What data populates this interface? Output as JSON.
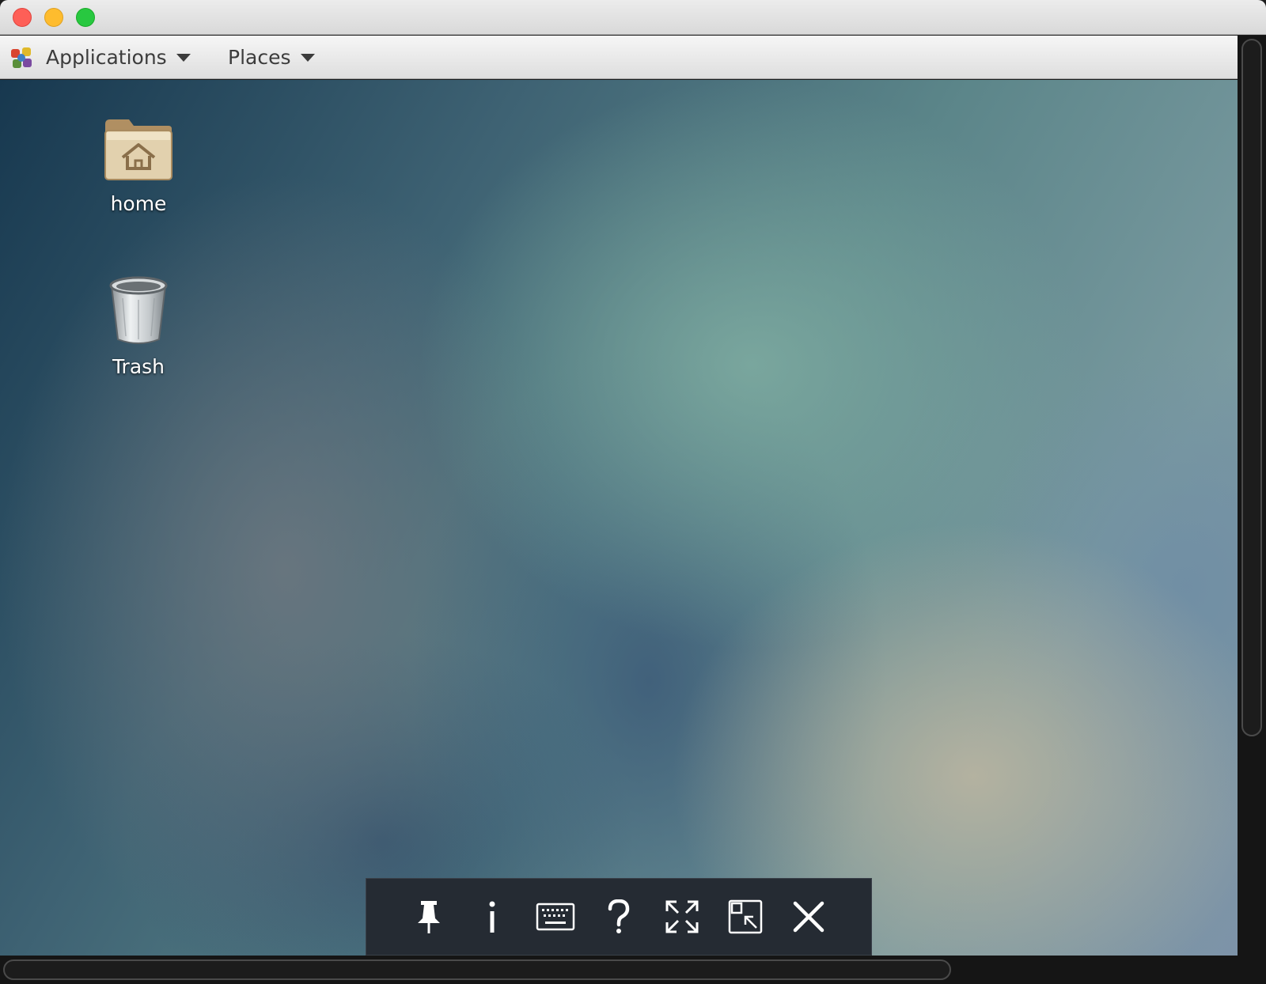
{
  "window": {
    "controls": [
      "close",
      "minimize",
      "maximize"
    ],
    "colors": {
      "close": "#fe5f57",
      "minimize": "#febc2e",
      "maximize": "#28c840"
    }
  },
  "panel": {
    "applications_label": "Applications",
    "places_label": "Places",
    "logo_icon": "gnome-foot-icon"
  },
  "desktop": {
    "icons": [
      {
        "label": "home",
        "icon": "home-folder-icon"
      },
      {
        "label": "Trash",
        "icon": "trash-can-icon"
      }
    ]
  },
  "toolbar": {
    "buttons": [
      {
        "name": "pin",
        "icon": "pin-icon"
      },
      {
        "name": "info",
        "icon": "info-icon"
      },
      {
        "name": "keyboard",
        "icon": "keyboard-icon"
      },
      {
        "name": "help",
        "icon": "help-icon"
      },
      {
        "name": "fullscreen",
        "icon": "fullscreen-icon"
      },
      {
        "name": "scale",
        "icon": "scale-icon"
      },
      {
        "name": "disconnect",
        "icon": "close-icon"
      }
    ]
  }
}
